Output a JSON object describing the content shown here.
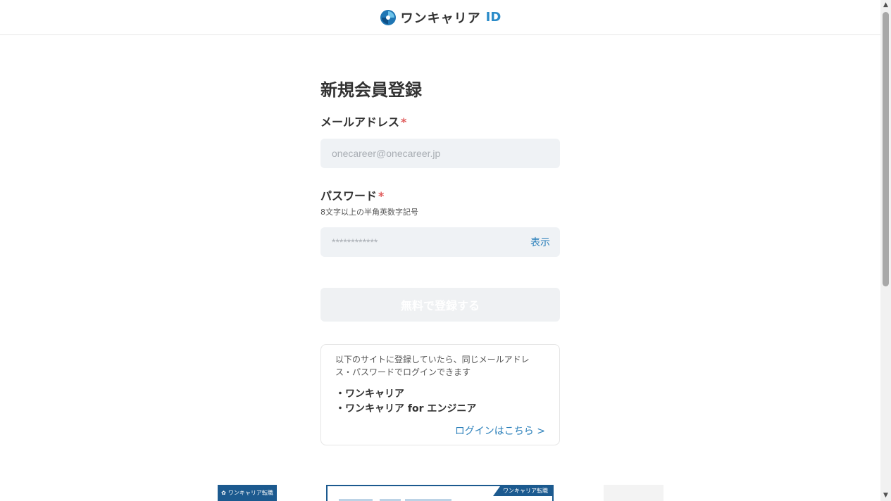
{
  "header": {
    "logo_text": "ワンキャリア",
    "logo_id": "ID"
  },
  "form": {
    "title": "新規会員登録",
    "email": {
      "label": "メールアドレス",
      "required_mark": "*",
      "placeholder": "onecareer@onecareer.jp",
      "value": ""
    },
    "password": {
      "label": "パスワード",
      "required_mark": "*",
      "hint": "8文字以上の半角英数字記号",
      "placeholder": "************",
      "value": "",
      "show_label": "表示"
    },
    "submit_label": "無料で登録する"
  },
  "info": {
    "text": "以下のサイトに登録していたら、同じメールアドレス・パスワードでログインできます",
    "sites": [
      "・ワンキャリア",
      "・ワンキャリア for エンジニア"
    ],
    "login_link": "ログインはこちら >"
  },
  "banners": {
    "left_text": "ワンキャリア転職",
    "mid_tag": "ワンキャリア転職"
  },
  "colors": {
    "accent": "#2a7fba",
    "required": "#e05a5a",
    "input_bg": "#eff2f5",
    "brand_dark": "#1c5a8f"
  }
}
